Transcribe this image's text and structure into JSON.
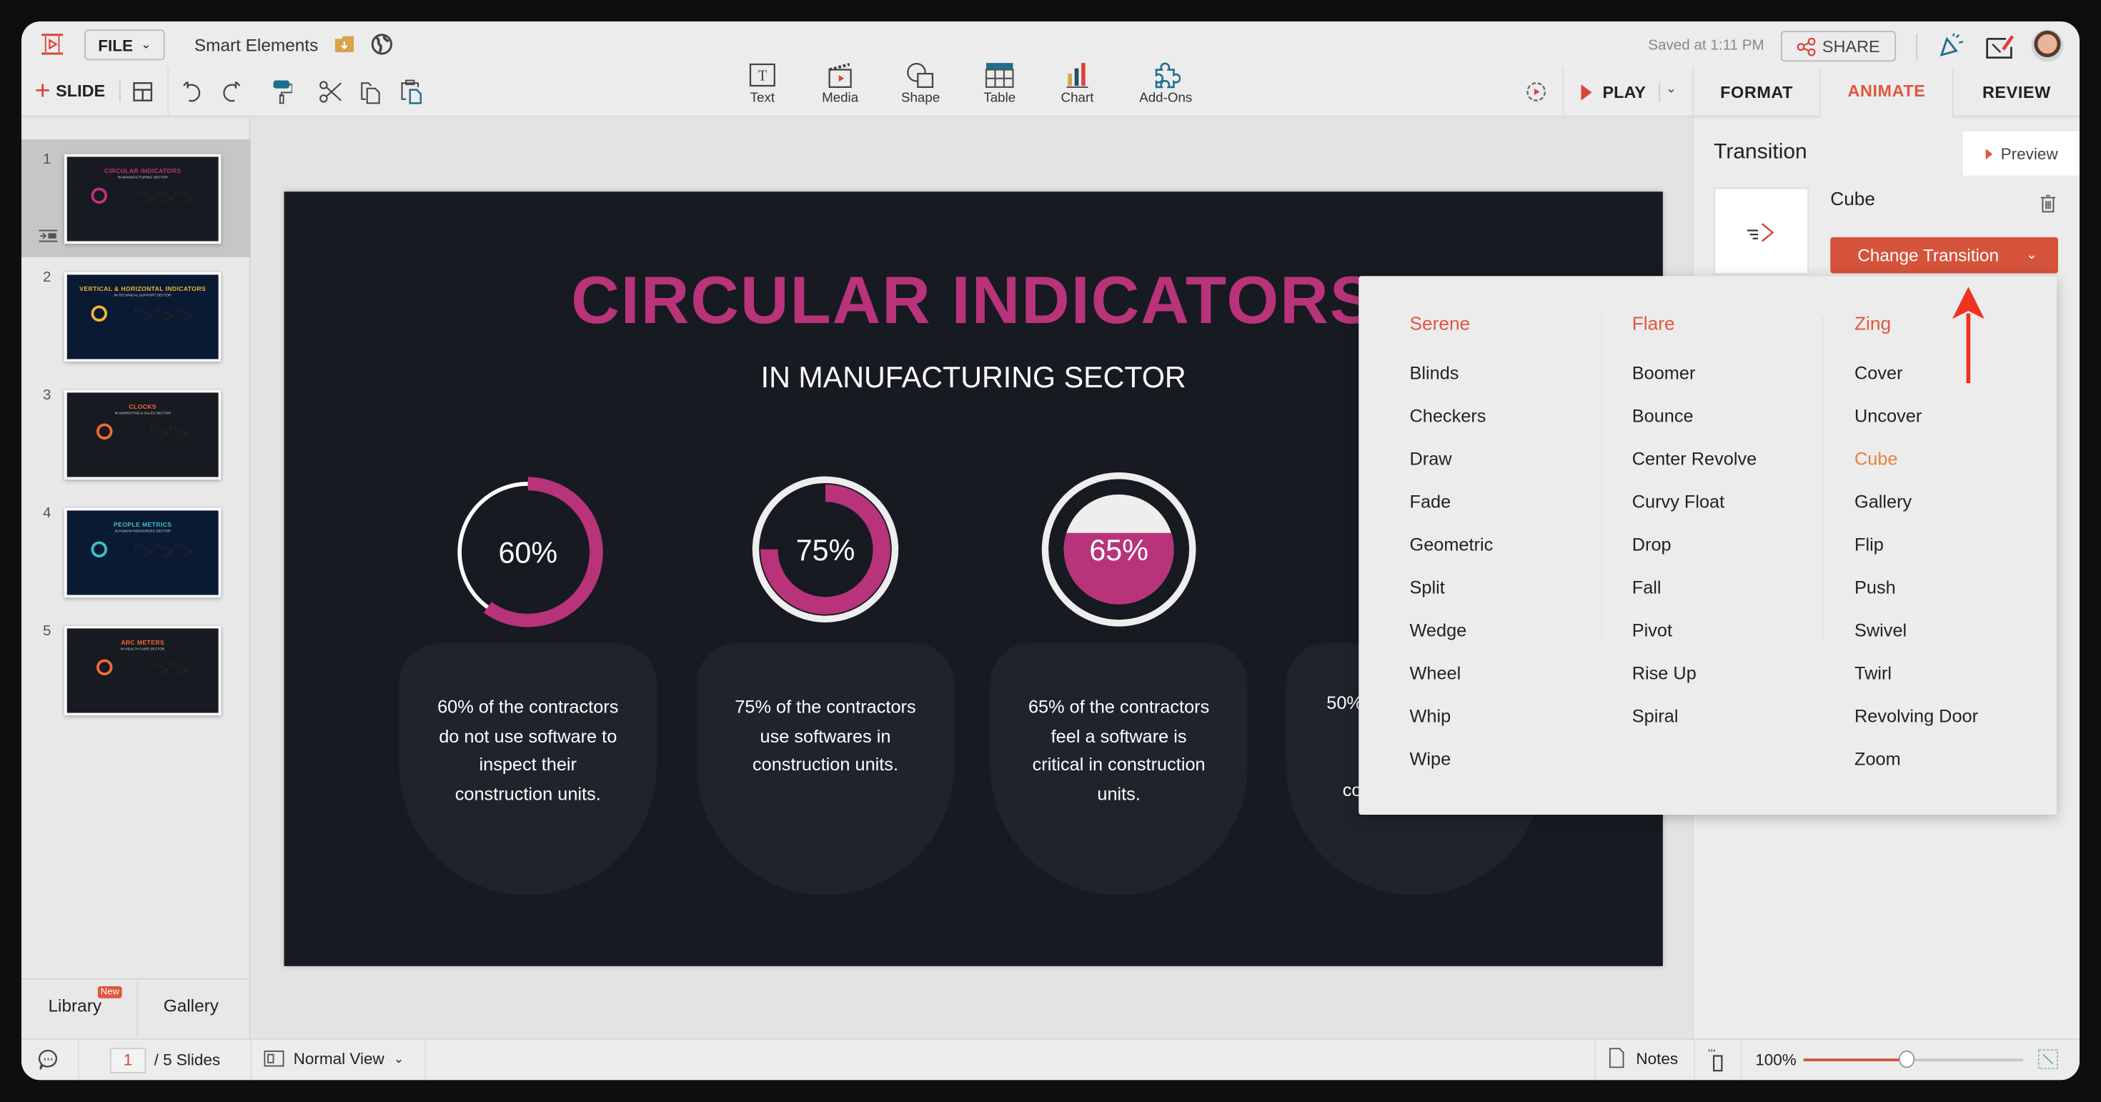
{
  "app": {
    "file_menu": "FILE",
    "doc_title": "Smart Elements",
    "saved_status": "Saved at 1:11 PM",
    "share_label": "SHARE"
  },
  "toolbar": {
    "add_slide": "SLIDE",
    "insert": [
      {
        "label": "Text",
        "icon": "text-box-icon"
      },
      {
        "label": "Media",
        "icon": "clapperboard-icon"
      },
      {
        "label": "Shape",
        "icon": "shape-icon"
      },
      {
        "label": "Table",
        "icon": "table-icon"
      },
      {
        "label": "Chart",
        "icon": "bar-chart-icon"
      },
      {
        "label": "Add-Ons",
        "icon": "puzzle-icon"
      }
    ],
    "play": "PLAY"
  },
  "tabs": [
    {
      "label": "FORMAT",
      "active": false
    },
    {
      "label": "ANIMATE",
      "active": true
    },
    {
      "label": "REVIEW",
      "active": false
    }
  ],
  "slides": [
    {
      "num": "1",
      "title": "CIRCULAR INDICATORS",
      "subtitle": "IN MANUFACTURING SECTOR",
      "title_color": "#c2307e",
      "bg": "#171a21"
    },
    {
      "num": "2",
      "title": "VERTICAL & HORIZONTAL INDICATORS",
      "subtitle": "IN TECHNICAL SUPPORT SECTOR",
      "title_color": "#f2b630",
      "bg": "#0b1a33"
    },
    {
      "num": "3",
      "title": "CLOCKS",
      "subtitle": "IN MARKETING & SALES SECTOR",
      "title_color": "#f06a35",
      "bg": "#171a21"
    },
    {
      "num": "4",
      "title": "PEOPLE METRICS",
      "subtitle": "IN HUMAN RESOURCES SECTOR",
      "title_color": "#3cc0c8",
      "bg": "#0b1a33"
    },
    {
      "num": "5",
      "title": "ARC METERS",
      "subtitle": "IN HEALTH CARE SECTOR",
      "title_color": "#f06a35",
      "bg": "#171a21"
    }
  ],
  "left_tabs": {
    "library": "Library",
    "new_badge": "New",
    "gallery": "Gallery"
  },
  "slide": {
    "title": "CIRCULAR INDICATORS",
    "subtitle": "IN MANUFACTURING SECTOR",
    "accent": "#b8337a",
    "indicators": [
      {
        "label": "60%",
        "value": 60,
        "lines": [
          "60% of the contractors",
          "do not use software to",
          "inspect their",
          "construction units."
        ]
      },
      {
        "label": "75%",
        "value": 75,
        "lines": [
          "75% of the contractors",
          "use softwares in",
          "construction units."
        ]
      },
      {
        "label": "65%",
        "value": 65,
        "lines": [
          "65% of the contractors",
          "feel a software is",
          "critical in construction",
          "units."
        ]
      },
      {
        "label": "50%",
        "value": 50,
        "visible_fragments": [
          "50%",
          "co"
        ]
      }
    ]
  },
  "panel": {
    "heading": "Transition",
    "preview": "Preview",
    "current": "Cube",
    "change_button": "Change Transition"
  },
  "dropdown": {
    "columns": [
      {
        "header": "Serene",
        "items": [
          "Blinds",
          "Checkers",
          "Draw",
          "Fade",
          "Geometric",
          "Split",
          "Wedge",
          "Wheel",
          "Whip",
          "Wipe"
        ]
      },
      {
        "header": "Flare",
        "items": [
          "Boomer",
          "Bounce",
          "Center Revolve",
          "Curvy Float",
          "Drop",
          "Fall",
          "Pivot",
          "Rise Up",
          "Spiral"
        ]
      },
      {
        "header": "Zing",
        "items": [
          "Cover",
          "Uncover",
          "Cube",
          "Gallery",
          "Flip",
          "Push",
          "Swivel",
          "Twirl",
          "Revolving Door",
          "Zoom"
        ]
      }
    ],
    "selected": "Cube",
    "header_color": "#e0573f",
    "selected_color": "#e8823a"
  },
  "status": {
    "page": "1",
    "total": "/ 5 Slides",
    "view": "Normal View",
    "notes": "Notes",
    "zoom": "100%",
    "zoom_level": 0.47
  }
}
